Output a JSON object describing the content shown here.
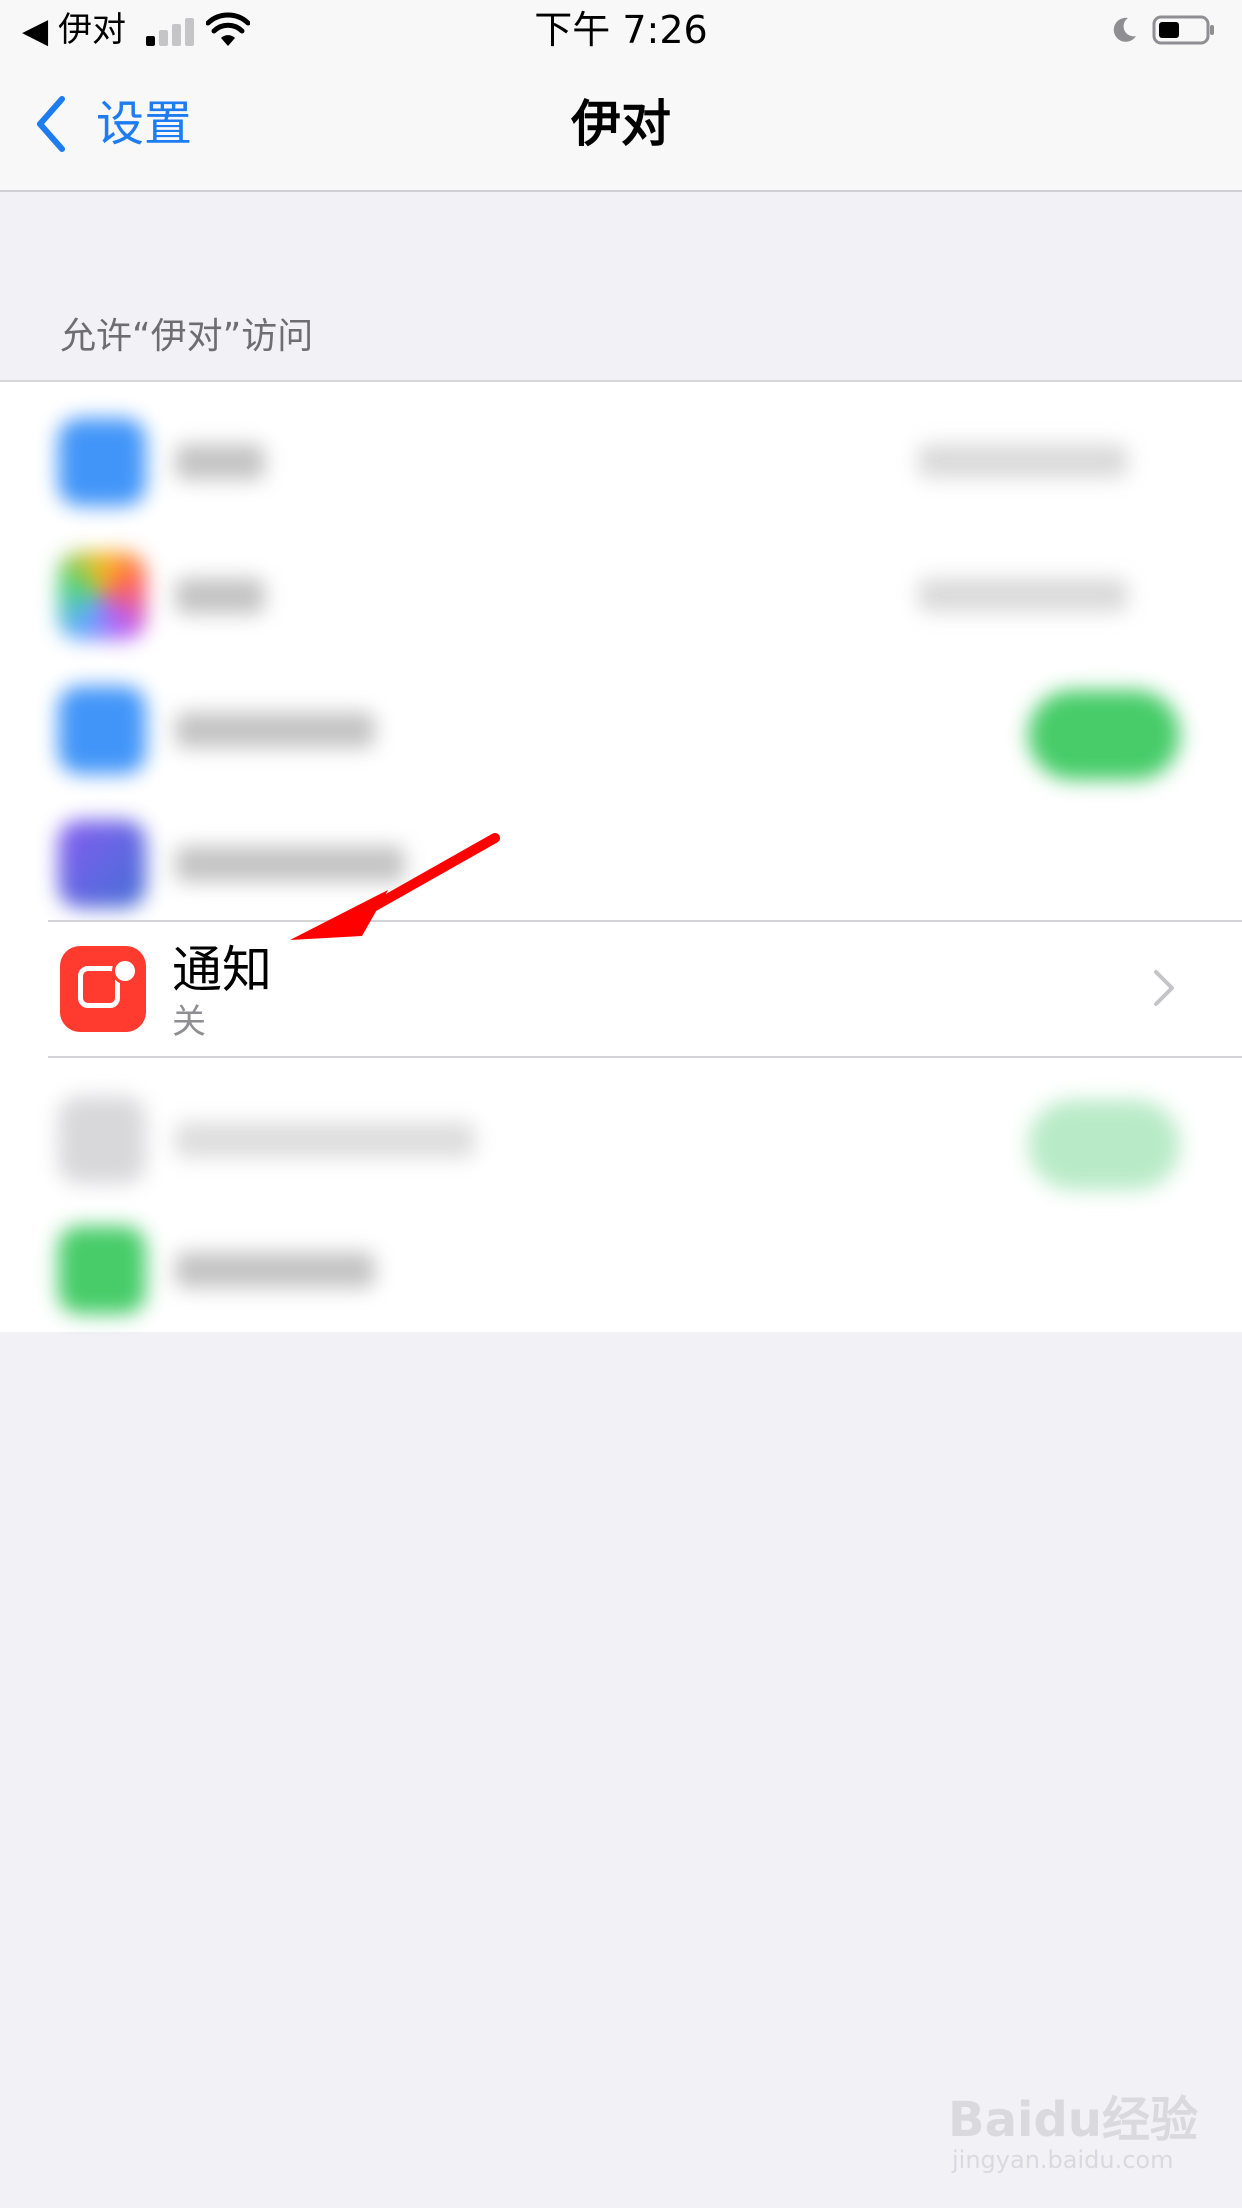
{
  "status_bar": {
    "back_glyph": "◀",
    "carrier": "伊对",
    "time": "下午 7:26",
    "icons": [
      "signal-icon",
      "wifi-icon",
      "moon-icon",
      "battery-icon"
    ]
  },
  "nav": {
    "back_label": "设置",
    "title": "伊对"
  },
  "section": {
    "header": "允许“伊对”访问"
  },
  "rows": {
    "notifications": {
      "title": "通知",
      "subtitle": "关",
      "icon": "notification-icon"
    }
  },
  "colors": {
    "accent": "#1d7cf2",
    "notification_icon_bg": "#ff3b30",
    "annotation_arrow": "#ff0000"
  },
  "watermark": {
    "main": "Baidu经验",
    "sub": "jingyan.baidu.com"
  }
}
